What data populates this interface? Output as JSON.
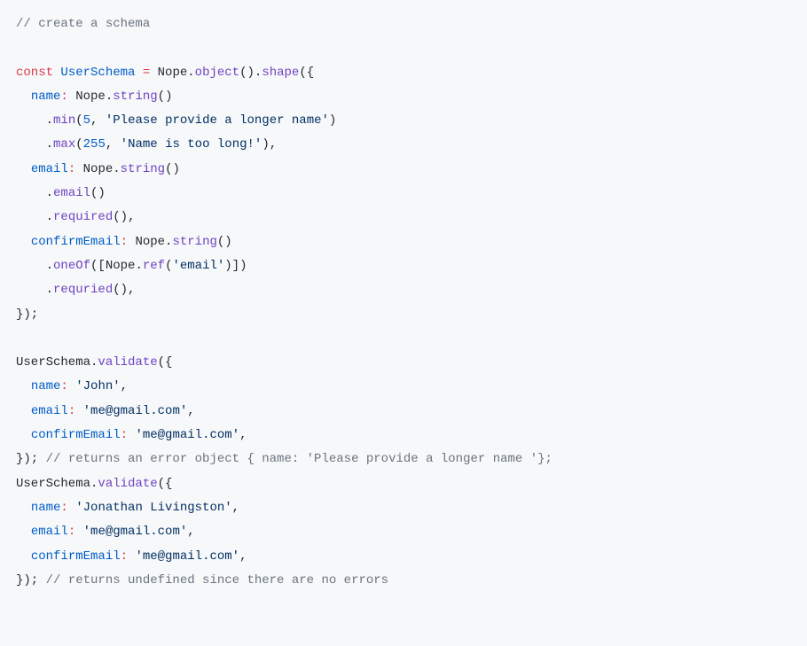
{
  "code": {
    "l1_comment": "// create a schema",
    "l2_const": "const",
    "l2_userschema": "UserSchema",
    "l2_eq": " = ",
    "l2_nope": "Nope",
    "l2_dot1": ".",
    "l2_object": "object",
    "l2_paren1": "().",
    "l2_shape": "shape",
    "l2_open": "({",
    "l3_name": "name",
    "l3_colon": ":",
    "l3_nope": " Nope.",
    "l3_string": "string",
    "l3_end": "()",
    "l4_dot": ".",
    "l4_min": "min",
    "l4_open": "(",
    "l4_num": "5",
    "l4_comma": ", ",
    "l4_str": "'Please provide a longer name'",
    "l4_close": ")",
    "l5_dot": ".",
    "l5_max": "max",
    "l5_open": "(",
    "l5_num": "255",
    "l5_comma": ", ",
    "l5_str": "'Name is too long!'",
    "l5_close": "),",
    "l6_email": "email",
    "l6_colon": ":",
    "l6_nope": " Nope.",
    "l6_string": "string",
    "l6_end": "()",
    "l7_dot": ".",
    "l7_email": "email",
    "l7_end": "()",
    "l8_dot": ".",
    "l8_required": "required",
    "l8_end": "(),",
    "l9_confirmemail": "confirmEmail",
    "l9_colon": ":",
    "l9_nope": " Nope.",
    "l9_string": "string",
    "l9_end": "()",
    "l10_dot": ".",
    "l10_oneof": "oneOf",
    "l10_open": "([Nope.",
    "l10_ref": "ref",
    "l10_open2": "(",
    "l10_str": "'email'",
    "l10_close": ")])",
    "l11_dot": ".",
    "l11_requried": "requried",
    "l11_end": "(),",
    "l12_close": "});",
    "l14_us": "UserSchema.",
    "l14_validate": "validate",
    "l14_open": "({",
    "l15_name": "name",
    "l15_colon": ":",
    "l15_sp": " ",
    "l15_str": "'John'",
    "l15_comma": ",",
    "l16_email": "email",
    "l16_colon": ":",
    "l16_sp": " ",
    "l16_str": "'me@gmail.com'",
    "l16_comma": ",",
    "l17_confirmemail": "confirmEmail",
    "l17_colon": ":",
    "l17_sp": " ",
    "l17_str": "'me@gmail.com'",
    "l17_comma": ",",
    "l18_close": "}); ",
    "l18_comment": "// returns an error object { name: 'Please provide a longer name '};",
    "l19_us": "UserSchema.",
    "l19_validate": "validate",
    "l19_open": "({",
    "l20_name": "name",
    "l20_colon": ":",
    "l20_sp": " ",
    "l20_str": "'Jonathan Livingston'",
    "l20_comma": ",",
    "l21_email": "email",
    "l21_colon": ":",
    "l21_sp": " ",
    "l21_str": "'me@gmail.com'",
    "l21_comma": ",",
    "l22_confirmemail": "confirmEmail",
    "l22_colon": ":",
    "l22_sp": " ",
    "l22_str": "'me@gmail.com'",
    "l22_comma": ",",
    "l23_close": "}); ",
    "l23_comment": "// returns undefined since there are no errors"
  }
}
